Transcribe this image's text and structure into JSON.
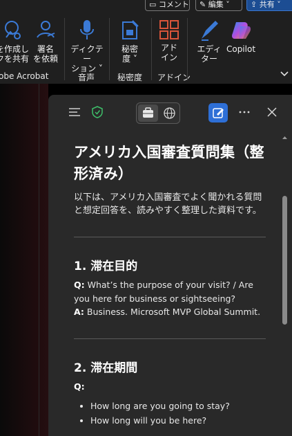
{
  "ribbon": {
    "top_buttons": {
      "comment": "コメント",
      "edit": "編集",
      "share": "共有"
    },
    "items": {
      "create_share": {
        "line1": "を作成し",
        "line2": "クを共有"
      },
      "sign": {
        "line1": "署名",
        "line2": "を依頼"
      },
      "dictate": {
        "line1": "ディクテー",
        "line2": "ション ˅"
      },
      "sensitivity": {
        "line1": "秘密",
        "line2": "度 ˅"
      },
      "addins": {
        "line1": "アド",
        "line2": "イン"
      },
      "editor": {
        "line1": "エディ",
        "line2": "ター"
      },
      "copilot": {
        "label": "Copilot"
      }
    },
    "groups": {
      "acrobat": "obe Acrobat",
      "voice": "音声",
      "sensitivity": "秘密度",
      "addins": "アドイン"
    },
    "colors": {
      "blue_accent": "#3b7ad6",
      "addin_orange": "#d9553a"
    }
  },
  "pane": {
    "doc_title": "アメリカ入国審査質問集（整形済み）",
    "intro": "以下は、アメリカ入国審査でよく聞かれる質問と想定回答を、読みやすく整理した資料です。",
    "sections": [
      {
        "heading": "1. 滞在目的",
        "q_label": "Q:",
        "q_text": " What’s the purpose of your visit? / Are you here for business or sightseeing?",
        "a_label": "A:",
        "a_text": " Business. Microsoft MVP Global Summit."
      },
      {
        "heading": "2. 滞在期間",
        "q_label": "Q:",
        "questions": [
          "How long are you going to stay?",
          "How long will you be here?"
        ]
      }
    ],
    "header_icons": [
      "menu-icon",
      "shield-check-icon",
      "briefcase-icon",
      "globe-icon",
      "new-chat-icon",
      "more-icon",
      "close-icon"
    ],
    "colors": {
      "pane_bg": "#292929",
      "new_chat_blue": "#2e6fd6",
      "shield_green": "#3ec06a"
    }
  }
}
